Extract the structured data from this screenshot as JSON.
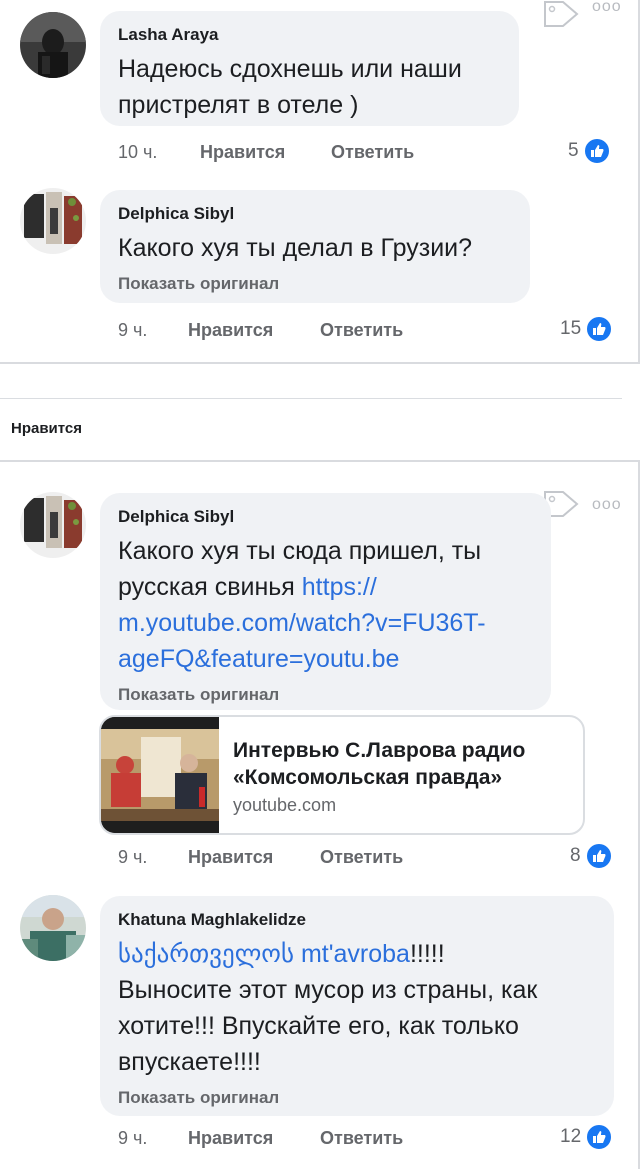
{
  "likes_section_label": "Нравится",
  "comments": [
    {
      "author": "Lasha Araya",
      "text_lines": [
        "Надеюсь сдохнешь или наши",
        "пристрелят в отеле )"
      ],
      "time": "10 ч.",
      "like_label": "Нравится",
      "reply_label": "Ответить",
      "reaction_count": "5"
    },
    {
      "author": "Delphica Sibyl",
      "text_lines": [
        "Какого хуя ты делал в Грузии?"
      ],
      "show_original": "Показать оригинал",
      "time": "9 ч.",
      "like_label": "Нравится",
      "reply_label": "Ответить",
      "reaction_count": "15"
    },
    {
      "author": "Delphica Sibyl",
      "text_line1": "Какого хуя ты сюда пришел, ты",
      "text_line2_plain": "русская свинья ",
      "text_line2_link": "https://",
      "link_line3": "m.youtube.com/watch?v=FU36T-",
      "link_line4": "ageFQ&feature=youtu.be",
      "show_original": "Показать оригинал",
      "preview": {
        "title_line1": "Интервью С.Лаврова радио",
        "title_line2": "«Комсомольская правда»",
        "domain": "youtube.com"
      },
      "time": "9 ч.",
      "like_label": "Нравится",
      "reply_label": "Ответить",
      "reaction_count": "8"
    },
    {
      "author": "Khatuna Maghlakelidze",
      "text_link_line": "საქართველოს mt'avroba",
      "text_link_suffix": "!!!!!",
      "text_lines": [
        "Выносите этот мусор из страны, как",
        "хотите!!! Впускайте его, как только",
        "впускаете!!!!"
      ],
      "show_original": "Показать оригинал",
      "time": "9 ч.",
      "like_label": "Нравится",
      "reply_label": "Ответить",
      "reaction_count": "12"
    }
  ],
  "colors": {
    "bubble": "#f0f2f5",
    "link": "#2b6fdc",
    "like_blue": "#1877f2",
    "secondary_text": "#65676b"
  },
  "icons": {
    "more": "more-options-icon",
    "tag": "tag-icon",
    "like": "like-thumb-icon"
  }
}
